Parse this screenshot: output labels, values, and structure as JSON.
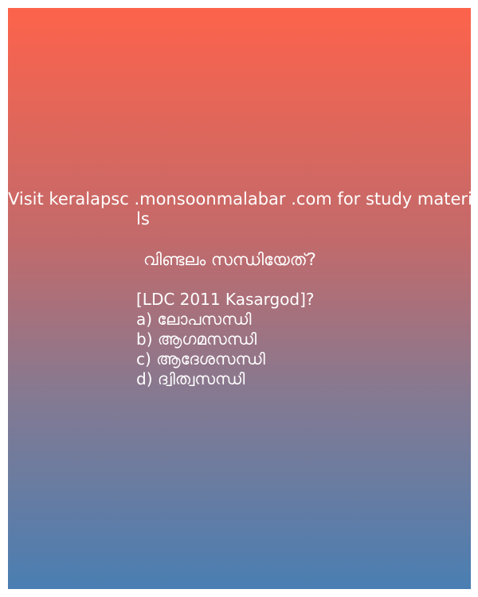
{
  "card": {
    "header_line1": "Visit keralapsc .monsoonmalabar .com for study materia",
    "header_line2": "ls",
    "question": "വിണ്ടലം സന്ധിയേത്?",
    "meta": "[LDC 2011 Kasargod]?",
    "options": [
      {
        "label": "a) ലോപസന്ധി"
      },
      {
        "label": "b) ആഗമസന്ധി"
      },
      {
        "label": "c) ആദേശസന്ധി"
      },
      {
        "label": "d) ദ്വിത്വസന്ധി"
      }
    ]
  },
  "colors": {
    "gradient_top": "#fd634b",
    "gradient_bottom": "#4a7eb2",
    "text": "#ffffff"
  }
}
